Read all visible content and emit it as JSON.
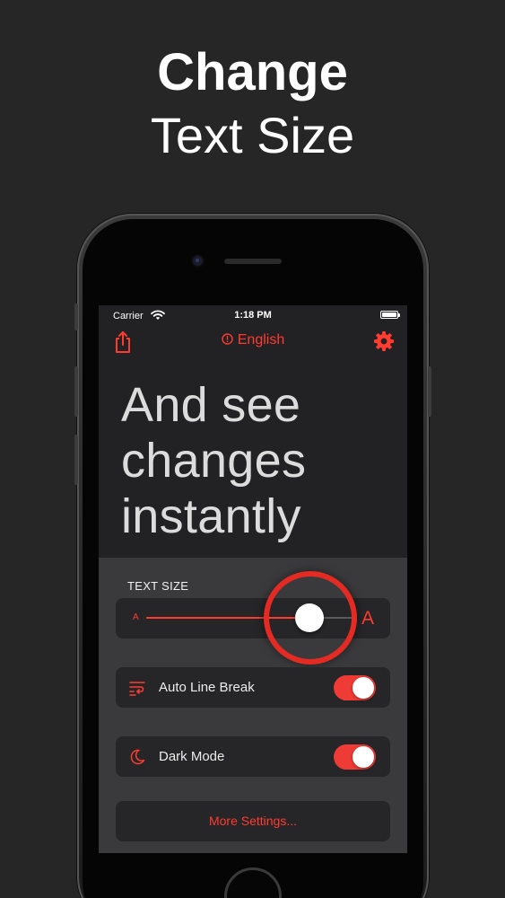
{
  "promo": {
    "headline_line1": "Change",
    "headline_line2": "Text Size"
  },
  "status_bar": {
    "carrier": "Carrier",
    "time": "1:18 PM"
  },
  "nav": {
    "language": "English",
    "share_icon": "share-icon",
    "info_icon": "info-circle-icon",
    "settings_icon": "gear-icon"
  },
  "preview": {
    "line1": "And see",
    "line2": "changes",
    "line3": "instantly"
  },
  "settings": {
    "text_size_label": "TEXT SIZE",
    "slider_min_label": "A",
    "slider_max_label": "A",
    "text_size_level": 0.79,
    "auto_line_break": {
      "label": "Auto Line Break",
      "enabled": true,
      "icon": "text-wrap-icon"
    },
    "dark_mode": {
      "label": "Dark Mode",
      "enabled": true,
      "icon": "moon-icon"
    },
    "more_settings_label": "More Settings..."
  },
  "colors": {
    "accent": "#ff3b30",
    "background": "#262626",
    "screen_bg": "#222224",
    "panel_bg": "#3a3a3c"
  }
}
